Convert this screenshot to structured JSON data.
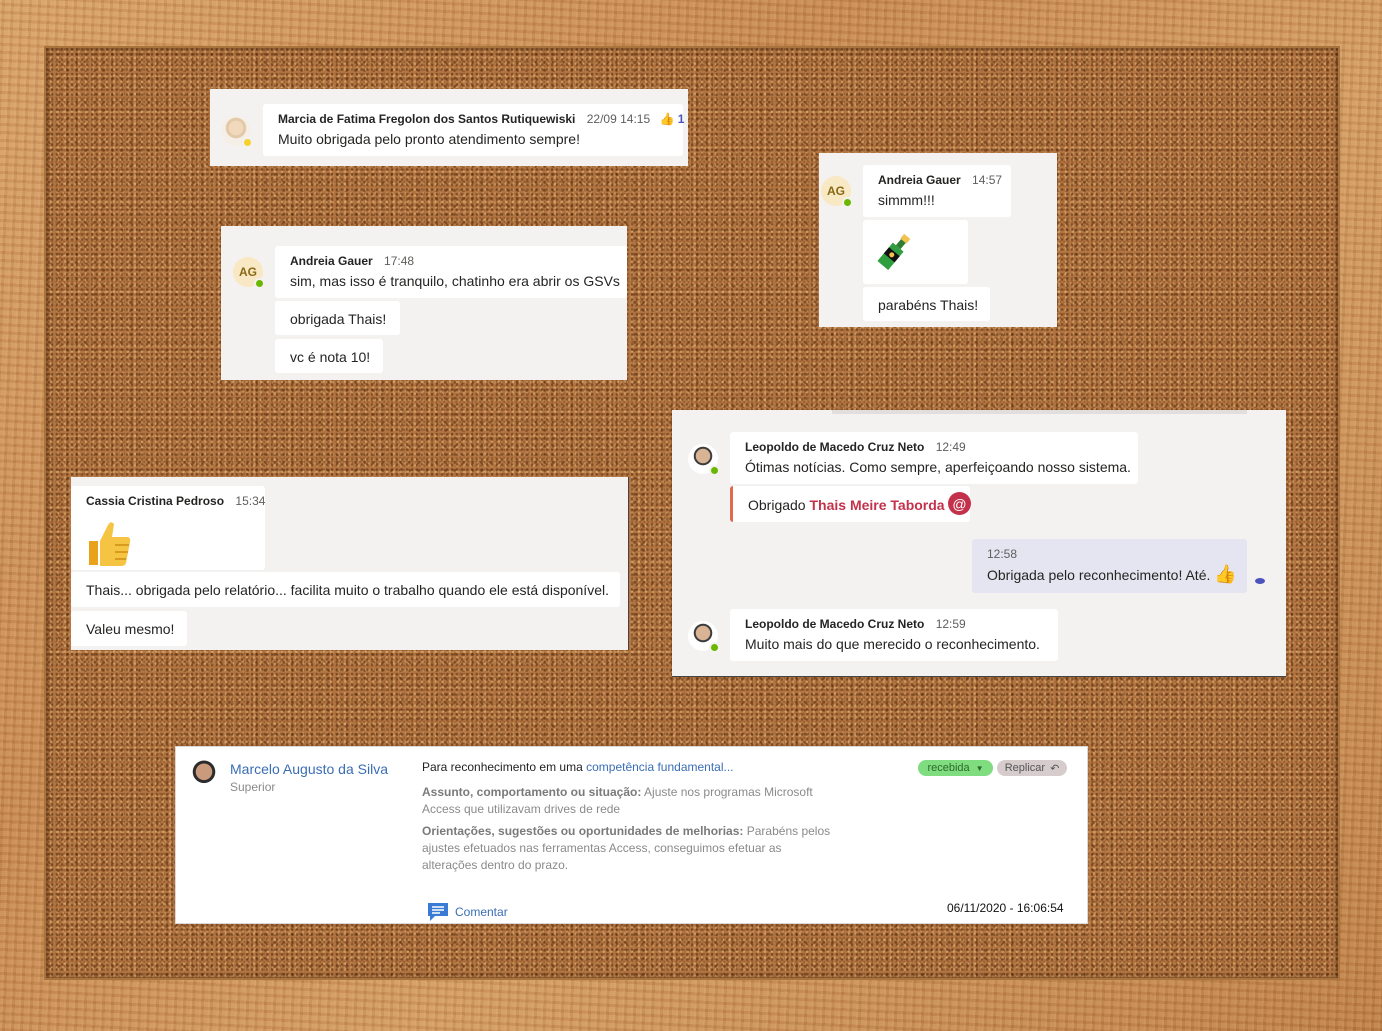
{
  "card_marcia": {
    "author": "Marcia de Fatima Fregolon dos Santos Rutiquewiski",
    "time": "22/09 14:15",
    "reaction_count": "1",
    "message": "Muito obrigada pelo pronto atendimento sempre!"
  },
  "card_andreia_1": {
    "initials": "AG",
    "author": "Andreia Gauer",
    "time": "14:57",
    "messages": [
      "simmm!!!",
      "parabéns Thais!"
    ]
  },
  "card_andreia_2": {
    "initials": "AG",
    "author": "Andreia Gauer",
    "time": "17:48",
    "messages": [
      "sim, mas isso é tranquilo, chatinho era abrir os GSVs",
      "obrigada Thais!",
      "vc é nota 10!"
    ]
  },
  "card_cassia": {
    "author": "Cassia Cristina Pedroso",
    "time": "15:34",
    "messages": [
      "Thais... obrigada pelo relatório... facilita muito o trabalho quando ele está disponível.",
      "Valeu mesmo!"
    ]
  },
  "card_leopoldo": {
    "author": "Leopoldo de Macedo Cruz Neto",
    "msg1_time": "12:49",
    "msg1": "Ótimas notícias. Como sempre, aperfeiçoando nosso sistema.",
    "reply_prefix": "Obrigado",
    "reply_mention": "Thais Meire Taborda",
    "self_time": "12:58",
    "self_msg": "Obrigada pelo reconhecimento!  Até.",
    "msg2_time": "12:59",
    "msg2": "Muito mais do que merecido o reconhecimento."
  },
  "recognition": {
    "sender_name": "Marcelo Augusto da Silva",
    "sender_role": "Superior",
    "intro": "Para reconhecimento em uma",
    "competency_link": "competência fundamental...",
    "status_pill": "recebida",
    "reply_button": "Replicar",
    "subject_label": "Assunto, comportamento ou situação:",
    "subject_text": "Ajuste nos programas Microsoft",
    "subject_text2": "Access que utilizavam drives de rede",
    "guidance_label": "Orientações, sugestões ou oportunidades de melhorias:",
    "guidance_text1": "Parabéns pelos",
    "guidance_text2": "ajustes efetuados nas ferramentas Access, conseguimos efetuar as",
    "guidance_text3": "alterações dentro do prazo.",
    "comment_link": "Comentar",
    "datetime": "06/11/2020 - 16:06:54"
  },
  "colors": {
    "teams_bg": "#f3f2f1",
    "mention_red": "#c4314b",
    "link_blue": "#3a6db5",
    "pill_green": "#7fdc7f"
  }
}
